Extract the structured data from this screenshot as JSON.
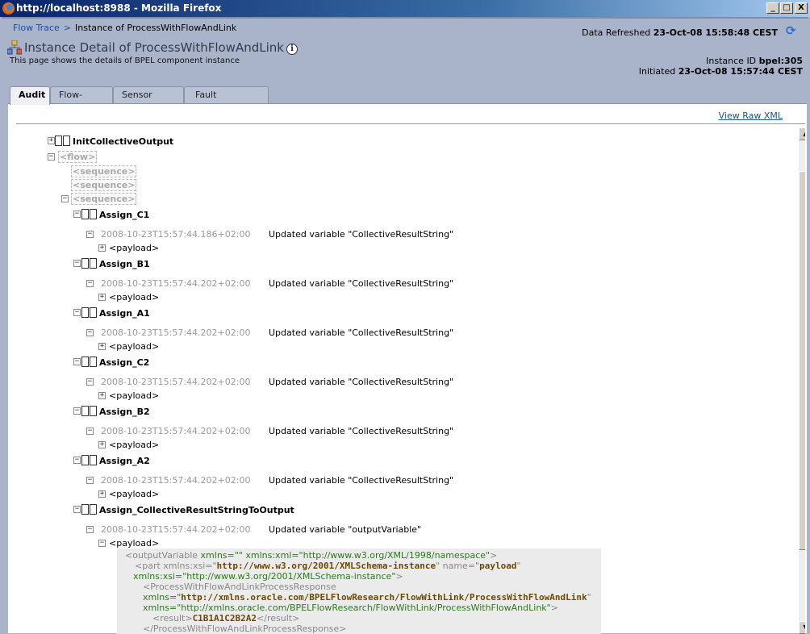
{
  "window": {
    "title": "http://localhost:8988 - Mozilla Firefox",
    "min": "_",
    "max": "□",
    "close": "X"
  },
  "breadcrumb": {
    "link": "Flow Trace",
    "sep": ">",
    "current": "Instance of ProcessWithFlowAndLink"
  },
  "header": {
    "title": "Instance Detail of ProcessWithFlowAndLink",
    "info": "i",
    "subtitle": "This page shows the details of BPEL component instance",
    "refreshed_label": "Data Refreshed",
    "refreshed_value": "23-Oct-08 15:58:48 CEST",
    "instance_label": "Instance ID",
    "instance_value": "bpel:305",
    "initiated_label": "Initiated",
    "initiated_value": "23-Oct-08 15:57:44 CEST"
  },
  "tabs": [
    "Audit",
    "Flow-Debug",
    "Sensor Values",
    "Fault Recovery"
  ],
  "view_raw_xml": "View Raw XML",
  "tree": {
    "init": "InitCollectiveOutput",
    "flow": "<flow>",
    "sequence": "<sequence>",
    "payload": "<payload>",
    "assigns": [
      {
        "name": "Assign_C1",
        "ts": "2008-10-23T15:57:44.186+02:00",
        "msg": "Updated variable \"CollectiveResultString\""
      },
      {
        "name": "Assign_B1",
        "ts": "2008-10-23T15:57:44.202+02:00",
        "msg": "Updated variable \"CollectiveResultString\""
      },
      {
        "name": "Assign_A1",
        "ts": "2008-10-23T15:57:44.202+02:00",
        "msg": "Updated variable \"CollectiveResultString\""
      },
      {
        "name": "Assign_C2",
        "ts": "2008-10-23T15:57:44.202+02:00",
        "msg": "Updated variable \"CollectiveResultString\""
      },
      {
        "name": "Assign_B2",
        "ts": "2008-10-23T15:57:44.202+02:00",
        "msg": "Updated variable \"CollectiveResultString\""
      },
      {
        "name": "Assign_A2",
        "ts": "2008-10-23T15:57:44.202+02:00",
        "msg": "Updated variable \"CollectiveResultString\""
      },
      {
        "name": "Assign_CollectiveResultStringToOutput",
        "ts": "2008-10-23T15:57:44.202+02:00",
        "msg": "Updated variable \"outputVariable\""
      }
    ]
  },
  "xml": {
    "l1a": "<outputVariable ",
    "l1b": "xmlns=\"\" xmlns:xml=\"http://www.w3.org/XML/1998/namespace\"",
    "l1c": ">",
    "l2a": "<part xmlns:xsi=\"",
    "l2b": "http://www.w3.org/2001/XMLSchema-instance",
    "l2c": "\" name=\"",
    "l2d": "payload",
    "l2e": "\"",
    "l3a": "xmlns:xsi=\"http://www.w3.org/2001/XMLSchema-instance\"",
    "l3b": ">",
    "l4": "<ProcessWithFlowAndLinkProcessResponse",
    "l5a": "xmlns=\"",
    "l5b": "http://xmlns.oracle.com/BPELFlowResearch/FlowWithLink/ProcessWithFlowAndLink",
    "l5c": "\"",
    "l6a": "xmlns=\"http://xmlns.oracle.com/BPELFlowResearch/FlowWithLink/ProcessWithFlowAndLink\"",
    "l6b": ">",
    "l7a": "<result>",
    "l7b": "C1B1A1C2B2A2",
    "l7c": "</result>",
    "l8": "</ProcessWithFlowAndLinkProcessResponse>"
  }
}
